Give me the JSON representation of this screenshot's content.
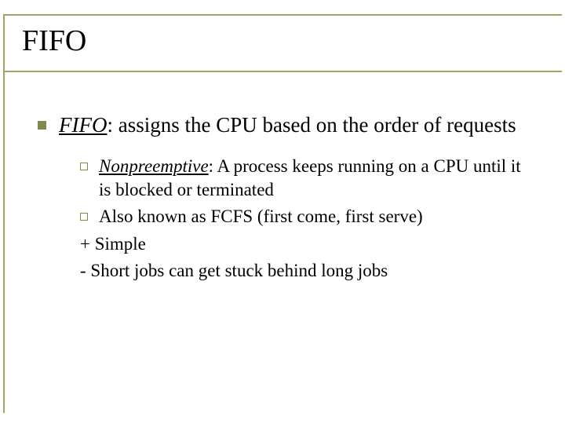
{
  "title": "FIFO",
  "main": {
    "term": "FIFO",
    "definition": ":  assigns the CPU based on the order of requests"
  },
  "sub": [
    {
      "emph": "Nonpreemptive",
      "rest": ":  A process keeps running on a CPU until it is blocked or terminated"
    },
    {
      "emph": "",
      "rest": "Also known as FCFS (first come, first serve)"
    }
  ],
  "plus": "+ Simple",
  "minus": "- Short jobs can get stuck behind long jobs"
}
